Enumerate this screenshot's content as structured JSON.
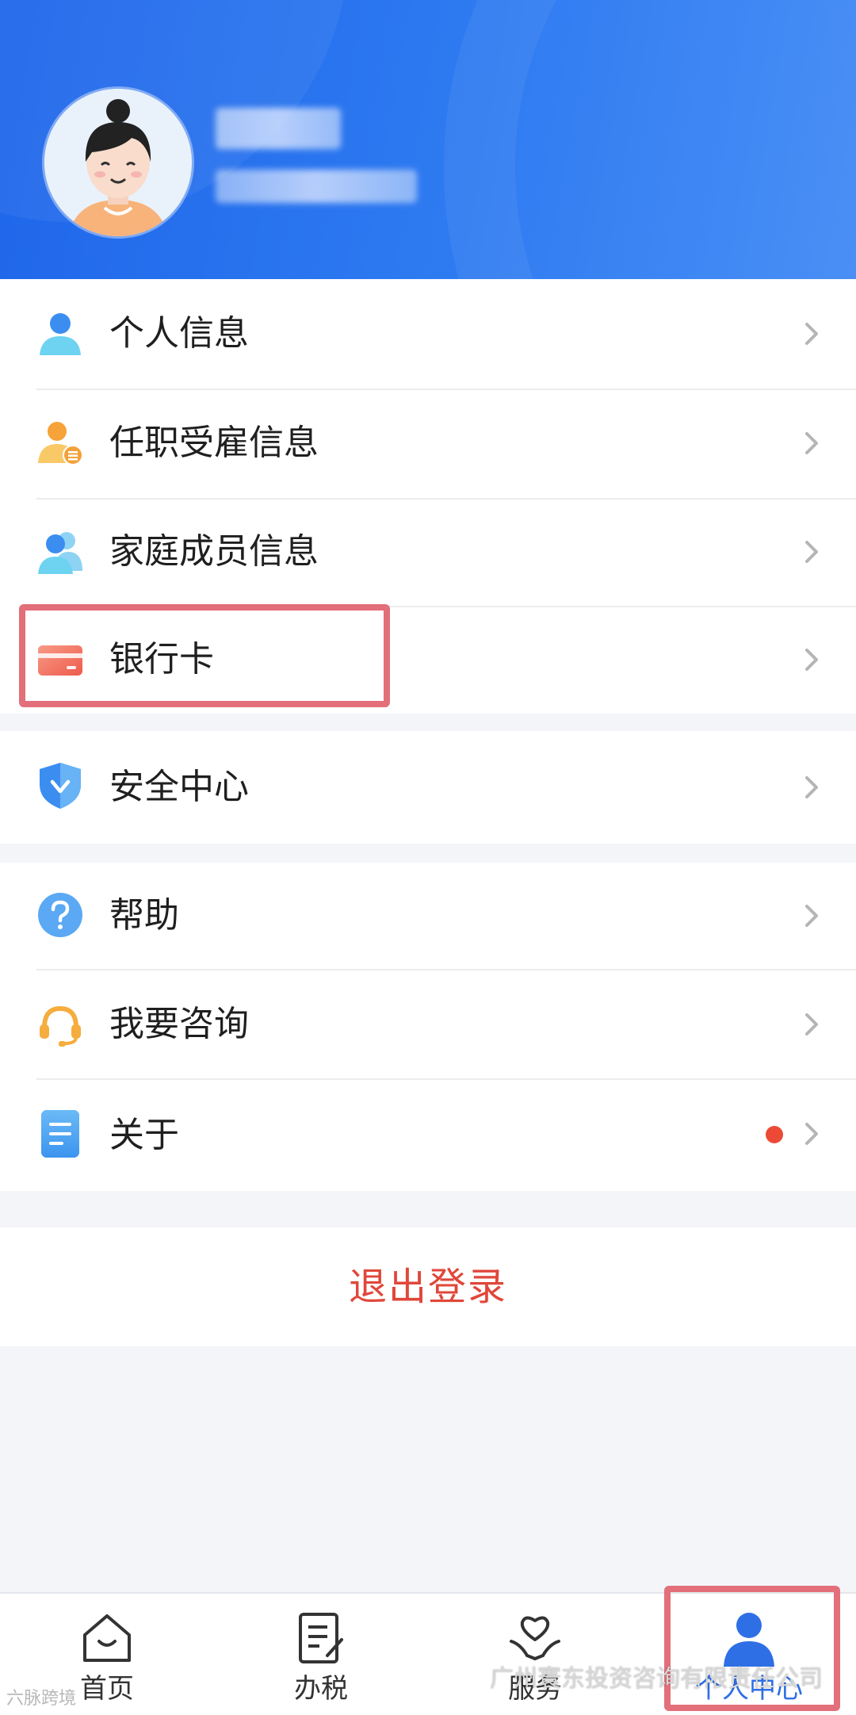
{
  "colors": {
    "header_blue": "#2068ea",
    "accent_blue": "#2f6fe6",
    "logout_red": "#e0473a",
    "badge_red": "#ec4a36",
    "highlight_pink": "#e26f79"
  },
  "header": {
    "avatar_icon": "woman-avatar-icon"
  },
  "menu": {
    "group1": [
      {
        "label": "个人信息",
        "icon": "person-icon"
      },
      {
        "label": "任职受雇信息",
        "icon": "employment-icon"
      },
      {
        "label": "家庭成员信息",
        "icon": "family-icon"
      },
      {
        "label": "银行卡",
        "icon": "bank-card-icon"
      }
    ],
    "group2": [
      {
        "label": "安全中心",
        "icon": "shield-icon"
      }
    ],
    "group3": [
      {
        "label": "帮助",
        "icon": "question-icon"
      },
      {
        "label": "我要咨询",
        "icon": "headset-icon"
      },
      {
        "label": "关于",
        "icon": "document-icon",
        "badge": true
      }
    ]
  },
  "logout": {
    "label": "退出登录"
  },
  "tabbar": [
    {
      "label": "首页",
      "icon": "home-icon"
    },
    {
      "label": "办税",
      "icon": "tax-form-icon"
    },
    {
      "label": "服务",
      "icon": "heart-hand-icon"
    },
    {
      "label": "个人中心",
      "icon": "profile-icon",
      "active": true
    }
  ],
  "watermark": {
    "left": "六脉跨境",
    "right": "广州寰东投资咨询有限责任公司"
  }
}
